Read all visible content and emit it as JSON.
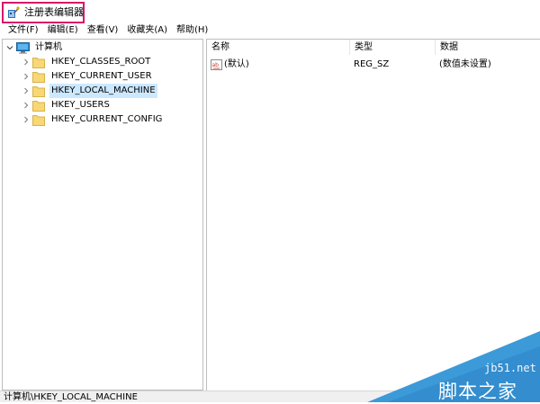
{
  "window": {
    "title": "注册表编辑器",
    "highlight_color": "#d6186a"
  },
  "menu": [
    {
      "label": "文件(F)"
    },
    {
      "label": "编辑(E)"
    },
    {
      "label": "查看(V)"
    },
    {
      "label": "收藏夹(A)"
    },
    {
      "label": "帮助(H)"
    }
  ],
  "tree": {
    "root": {
      "label": "计算机",
      "icon": "computer-icon",
      "expanded": true
    },
    "keys": [
      {
        "label": "HKEY_CLASSES_ROOT",
        "icon": "folder-icon",
        "selected": false
      },
      {
        "label": "HKEY_CURRENT_USER",
        "icon": "folder-icon",
        "selected": false
      },
      {
        "label": "HKEY_LOCAL_MACHINE",
        "icon": "folder-icon",
        "selected": true
      },
      {
        "label": "HKEY_USERS",
        "icon": "folder-icon",
        "selected": false
      },
      {
        "label": "HKEY_CURRENT_CONFIG",
        "icon": "folder-icon",
        "selected": false
      }
    ],
    "selection_color": "#cce8ff",
    "folder_color": "#f8d775"
  },
  "list": {
    "columns": [
      "名称",
      "类型",
      "数据"
    ],
    "rows": [
      {
        "icon": "string-value-icon",
        "name": "(默认)",
        "type": "REG_SZ",
        "data": "(数值未设置)"
      }
    ]
  },
  "status": {
    "path": "计算机\\HKEY_LOCAL_MACHINE"
  },
  "watermark": {
    "url": "jb51.net",
    "brand": "脚本之家",
    "band_color": "#3c9ad8"
  }
}
